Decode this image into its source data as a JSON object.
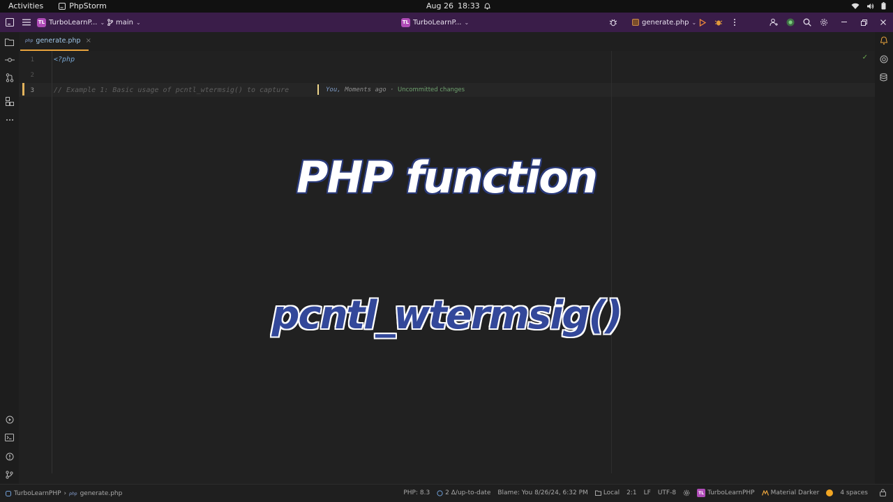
{
  "topbar": {
    "activities": "Activities",
    "app_name": "PhpStorm",
    "date": "Aug 26",
    "time": "18:33"
  },
  "toolbar": {
    "project_badge": "TL",
    "project_name": "TurboLearnP...",
    "branch": "main",
    "center_badge": "TL",
    "center_project": "TurboLearnP...",
    "run_config": "generate.php"
  },
  "tabs": [
    {
      "label": "generate.php",
      "icon": "php-file-icon"
    }
  ],
  "editor": {
    "line_numbers": [
      "1",
      "2",
      "3"
    ],
    "lines": [
      "<?php",
      "",
      "// Example 1: Basic usage of pcntl_wtermsig() to capture "
    ],
    "blame": {
      "author": "You,",
      "when": "Moments ago",
      "separator": "·",
      "status": "Uncommitted changes"
    }
  },
  "overlay": {
    "title": "PHP function",
    "function_name": "pcntl_wtermsig()"
  },
  "statusbar": {
    "project": "TurboLearnPHP",
    "file": "generate.php",
    "php_version": "PHP: 8.3",
    "vcs": "2 Δ/up-to-date",
    "blame": "Blame: You 8/26/24, 6:32 PM",
    "local": "Local",
    "position": "2:1",
    "line_ending": "LF",
    "encoding": "UTF-8",
    "project_badge": "TL",
    "project_name": "TurboLearnPHP",
    "theme": "Material Darker",
    "indent": "4 spaces"
  },
  "colors": {
    "toolbar_bg": "#3a1d49",
    "editor_bg": "#212121",
    "accent_orange": "#e8a33d",
    "badge_purple": "#b04cb8"
  }
}
